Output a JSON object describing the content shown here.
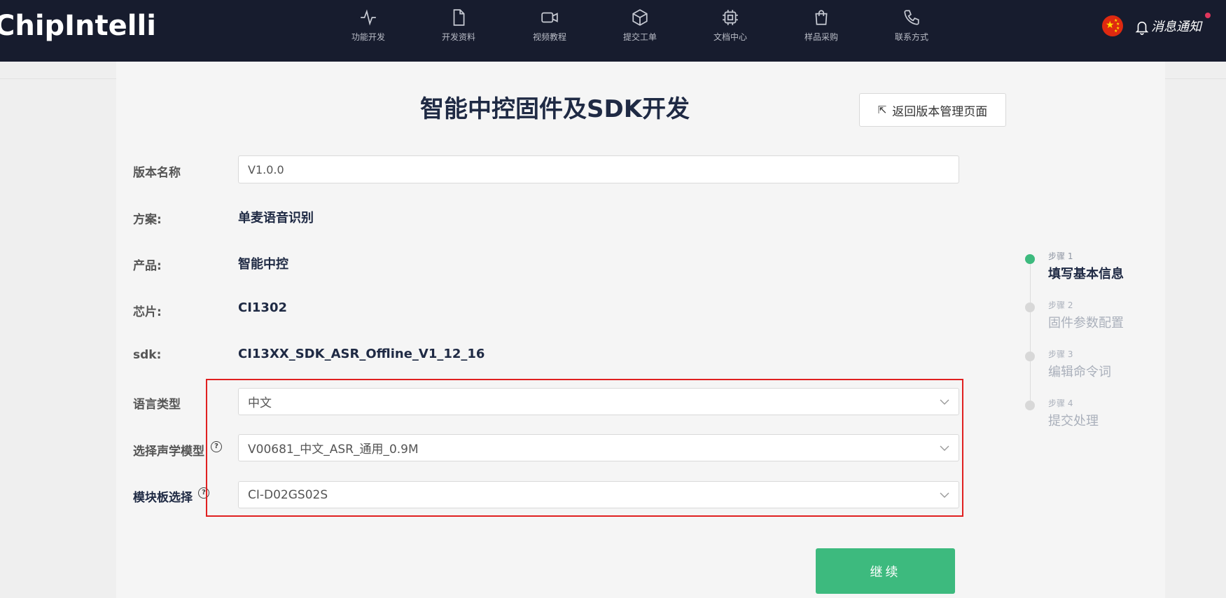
{
  "header": {
    "logo": "ChipIntelli",
    "nav": [
      {
        "label": "功能开发",
        "icon": "activity-icon"
      },
      {
        "label": "开发资料",
        "icon": "file-icon"
      },
      {
        "label": "视频教程",
        "icon": "video-icon"
      },
      {
        "label": "提交工单",
        "icon": "box-icon"
      },
      {
        "label": "文档中心",
        "icon": "chip-icon"
      },
      {
        "label": "样品采购",
        "icon": "shopping-bag-icon"
      },
      {
        "label": "联系方式",
        "icon": "phone-icon"
      }
    ],
    "notice": "消息通知"
  },
  "page": {
    "title": "智能中控固件及SDK开发",
    "back_label": "返回版本管理页面"
  },
  "form": {
    "version_label": "版本名称",
    "version_value": "V1.0.0",
    "scheme_label": "方案:",
    "scheme_value": "单麦语音识别",
    "product_label": "产品:",
    "product_value": "智能中控",
    "chip_label": "芯片:",
    "chip_value": "CI1302",
    "sdk_label": "sdk:",
    "sdk_value": "CI13XX_SDK_ASR_Offline_V1_12_16",
    "language_label": "语言类型",
    "language_value": "中文",
    "model_label": "选择声学模型",
    "model_value": "V00681_中文_ASR_通用_0.9M",
    "board_label": "模块板选择",
    "board_value": "CI-D02GS02S",
    "continue_label": "继续"
  },
  "steps": [
    {
      "num": "步骤 1",
      "title": "填写基本信息",
      "active": true
    },
    {
      "num": "步骤 2",
      "title": "固件参数配置",
      "active": false
    },
    {
      "num": "步骤 3",
      "title": "编辑命令词",
      "active": false
    },
    {
      "num": "步骤 4",
      "title": "提交处理",
      "active": false
    }
  ],
  "colors": {
    "header_bg": "#171c2e",
    "accent_green": "#3dba7e",
    "highlight_red": "#e02020",
    "title_navy": "#1f2a44"
  }
}
